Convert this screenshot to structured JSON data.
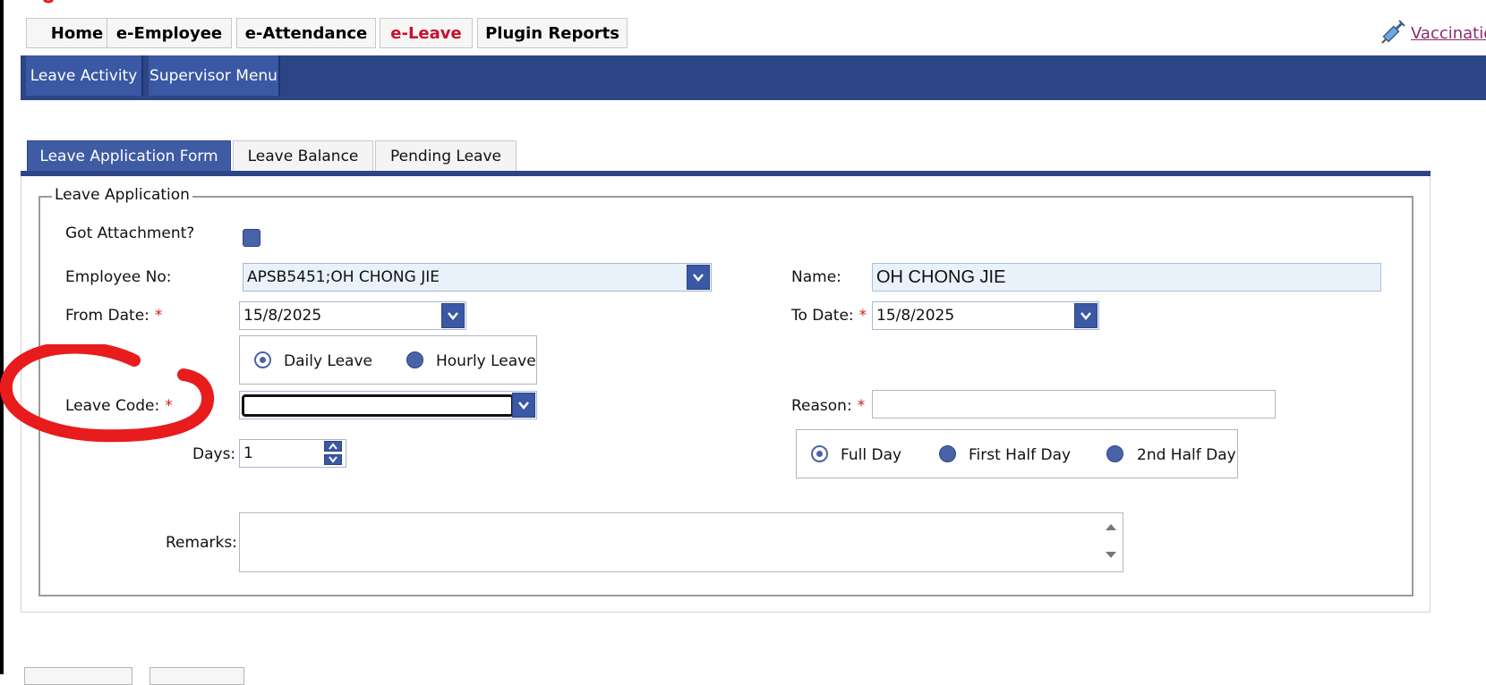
{
  "nav": {
    "items": [
      {
        "label": "Home"
      },
      {
        "label": "e-Employee"
      },
      {
        "label": "e-Attendance"
      },
      {
        "label": "e-Leave",
        "active": true
      },
      {
        "label": "Plugin Reports"
      }
    ],
    "active_color": "#c8102e",
    "vaccination_link": "Vaccination"
  },
  "submenu": {
    "items": [
      {
        "label": "Leave Activity"
      },
      {
        "label": "Supervisor Menu"
      }
    ],
    "bar_color": "#2c4585"
  },
  "tabs": [
    {
      "label": "Leave Application Form",
      "active": true
    },
    {
      "label": "Leave Balance"
    },
    {
      "label": "Pending Leave"
    }
  ],
  "form": {
    "legend": "Leave Application",
    "attachment_label": "Got Attachment?",
    "employee_no_label": "Employee No:",
    "employee_no_value": "APSB5451;OH CHONG JIE",
    "name_label": "Name:",
    "name_value": "OH CHONG JIE",
    "from_date_label": "From Date:",
    "from_date_value": "15/8/2025",
    "to_date_label": "To Date:",
    "to_date_value": "15/8/2025",
    "required_mark": "*",
    "leave_type_options": [
      {
        "label": "Daily Leave",
        "checked": true
      },
      {
        "label": "Hourly Leave",
        "checked": false
      }
    ],
    "leave_code_label": "Leave Code:",
    "leave_code_value": "",
    "reason_label": "Reason:",
    "reason_value": "",
    "days_label": "Days:",
    "days_value": "1",
    "day_portion_options": [
      {
        "label": "Full Day",
        "checked": true
      },
      {
        "label": "First Half Day",
        "checked": false
      },
      {
        "label": "2nd Half Day",
        "checked": false
      }
    ],
    "remarks_label": "Remarks:",
    "remarks_value": ""
  },
  "annotation_color": "#e81c1c"
}
